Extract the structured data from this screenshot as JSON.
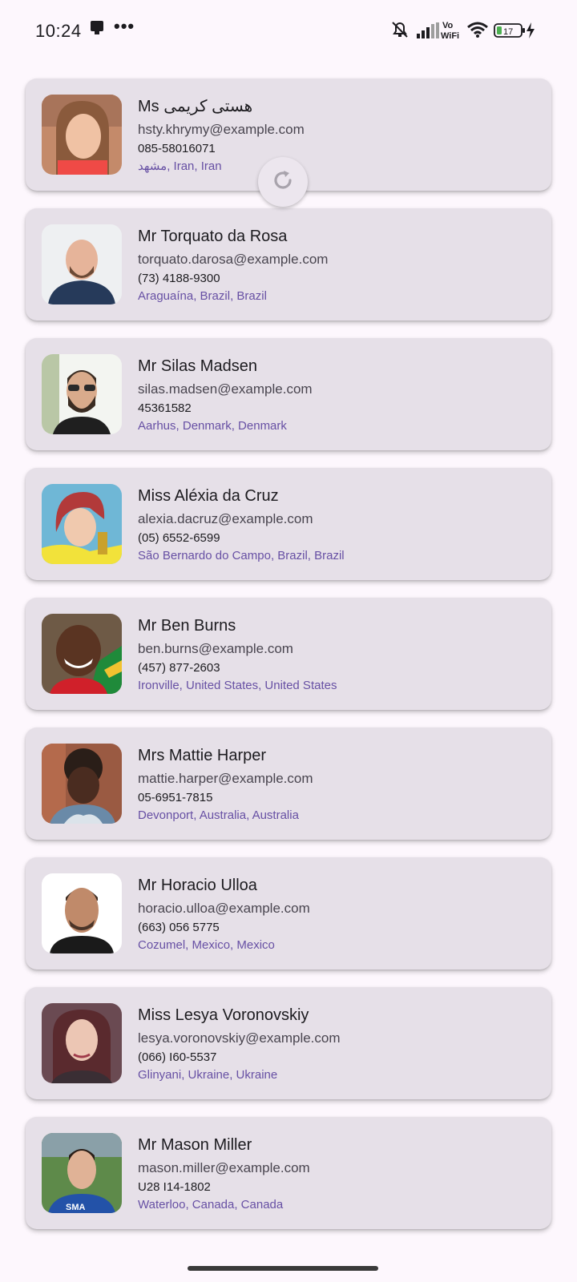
{
  "status_bar": {
    "time": "10:24",
    "battery_level": "17",
    "icons": [
      "notification-icon",
      "more-icon",
      "mute-icon",
      "signal-icon",
      "vowifi-icon",
      "wifi-icon",
      "battery-icon",
      "charging-icon"
    ]
  },
  "refresh_indicator": {
    "icon": "refresh-icon"
  },
  "contacts": [
    {
      "name": "Ms هستی کریمی",
      "email": "hsty.khrymy@example.com",
      "phone": "085-58016071",
      "location": "مشهد, Iran, Iran"
    },
    {
      "name": "Mr Torquato da Rosa",
      "email": "torquato.darosa@example.com",
      "phone": "(73) 4188-9300",
      "location": "Araguaína, Brazil, Brazil"
    },
    {
      "name": "Mr Silas Madsen",
      "email": "silas.madsen@example.com",
      "phone": "45361582",
      "location": "Aarhus, Denmark, Denmark"
    },
    {
      "name": "Miss Aléxia da Cruz",
      "email": "alexia.dacruz@example.com",
      "phone": "(05) 6552-6599",
      "location": "São Bernardo do Campo, Brazil, Brazil"
    },
    {
      "name": "Mr Ben Burns",
      "email": "ben.burns@example.com",
      "phone": "(457) 877-2603",
      "location": "Ironville, United States, United States"
    },
    {
      "name": "Mrs Mattie Harper",
      "email": "mattie.harper@example.com",
      "phone": "05-6951-7815",
      "location": "Devonport, Australia, Australia"
    },
    {
      "name": "Mr Horacio Ulloa",
      "email": "horacio.ulloa@example.com",
      "phone": "(663) 056 5775",
      "location": "Cozumel, Mexico, Mexico"
    },
    {
      "name": "Miss Lesya Voronovskiy",
      "email": "lesya.voronovskiy@example.com",
      "phone": "(066) I60-5537",
      "location": "Glinyani, Ukraine, Ukraine"
    },
    {
      "name": "Mr Mason Miller",
      "email": "mason.miller@example.com",
      "phone": "U28 I14-1802",
      "location": "Waterloo, Canada, Canada"
    }
  ],
  "colors": {
    "background": "#fdf7fd",
    "card": "#e6e0e8",
    "location_text": "#6750a4"
  }
}
